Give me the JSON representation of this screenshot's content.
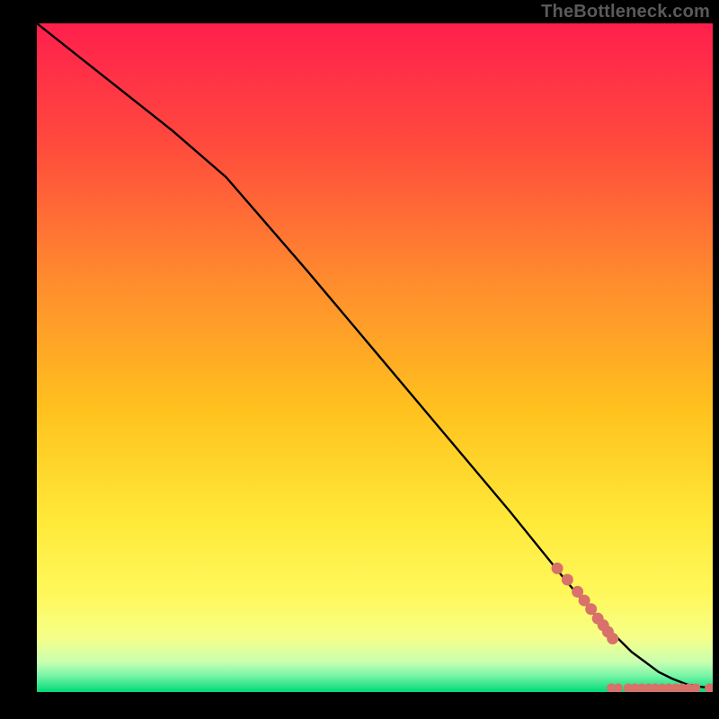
{
  "watermark": "TheBottleneck.com",
  "colors": {
    "gradient_top": "#ff1f4d",
    "gradient_mid1": "#ff7a2e",
    "gradient_mid2": "#ffd400",
    "gradient_mid3": "#ffef55",
    "gradient_bottom_light": "#d8ff9a",
    "gradient_bottom": "#00d976",
    "line": "#000000",
    "dot": "#d9716b"
  },
  "chart_data": {
    "type": "line",
    "title": "",
    "xlabel": "",
    "ylabel": "",
    "xlim": [
      0,
      100
    ],
    "ylim": [
      0,
      100
    ],
    "series": [
      {
        "name": "curve",
        "x": [
          0,
          10,
          20,
          28,
          40,
          50,
          60,
          70,
          78,
          83,
          86,
          88,
          90,
          92,
          94,
          96,
          98,
          100
        ],
        "y": [
          100,
          92,
          84,
          77,
          63,
          51,
          39,
          27,
          17,
          11,
          8,
          6,
          4.5,
          3,
          2,
          1.2,
          0.8,
          0.6
        ]
      }
    ],
    "dots_on_curve": {
      "x": [
        77,
        78.5,
        80,
        81,
        82,
        83,
        83.8,
        84.5,
        85.2
      ],
      "y": [
        18.5,
        16.8,
        15,
        13.7,
        12.4,
        11,
        10,
        9,
        8
      ]
    },
    "dots_on_floor": {
      "x": [
        85,
        86,
        87.5,
        88.5,
        89.5,
        90.5,
        91.5,
        92.5,
        93.5,
        94.5,
        95.5,
        96.5,
        97.5,
        99.5
      ],
      "y": [
        0.6,
        0.6,
        0.6,
        0.6,
        0.6,
        0.6,
        0.6,
        0.6,
        0.6,
        0.6,
        0.6,
        0.6,
        0.6,
        0.6
      ]
    }
  }
}
